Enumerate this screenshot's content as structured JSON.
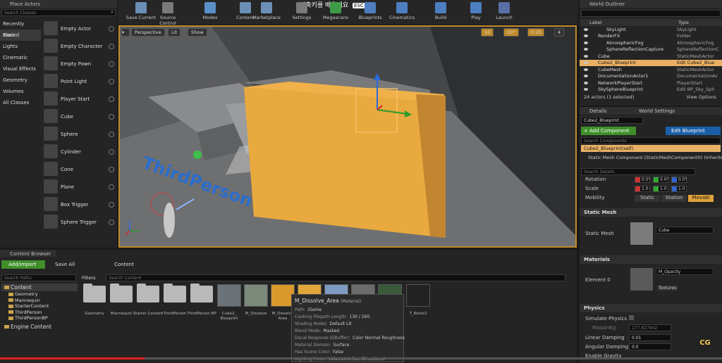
{
  "place_actors": {
    "title": "Place Actors",
    "search_placeholder": "Search Classes",
    "categories": [
      "Recently Placed",
      "Basic",
      "Lights",
      "Cinematic",
      "Visual Effects",
      "Geometry",
      "Volumes",
      "All Classes"
    ],
    "items": [
      "Empty Actor",
      "Empty Character",
      "Empty Pawn",
      "Point Light",
      "Player Start",
      "Cube",
      "Sphere",
      "Cylinder",
      "Cone",
      "Plane",
      "Box Trigger",
      "Sphere Trigger"
    ]
  },
  "toolbar": {
    "overlay_text": "단축키를 배우세요",
    "esc_key": "ESC",
    "buttons": [
      "Save Current",
      "Source Control",
      "Modes",
      "Content",
      "Marketplace",
      "Settings",
      "Megascans",
      "Blueprints",
      "Cinematics",
      "Build",
      "Play",
      "Launch"
    ]
  },
  "viewport": {
    "perspective": "Perspective",
    "lit": "Lit",
    "show": "Show",
    "snap_grid": "10",
    "snap_rot": "10°",
    "snap_scale": "0.25",
    "cam_speed": "4",
    "floor_text": "ThirdPerson"
  },
  "outliner": {
    "title": "World Outliner",
    "col_label": "Label",
    "col_type": "Type",
    "rows": [
      {
        "label": "SkyLight",
        "type": "SkyLight"
      },
      {
        "label": "RenderFX",
        "type": "Folder"
      },
      {
        "label": "AtmosphericFog",
        "type": "AtmosphericFog"
      },
      {
        "label": "SphereReflectionCapture",
        "type": "SphereReflectionC"
      },
      {
        "label": "Cube",
        "type": "StaticMeshActor"
      },
      {
        "label": "Cube2_Blueprint",
        "type": "Edit Cube2_Blue"
      },
      {
        "label": "CubeMesh",
        "type": "StaticMeshActor"
      },
      {
        "label": "DocumentationActor1",
        "type": "DocumentationAc"
      },
      {
        "label": "NetworkPlayerStart",
        "type": "PlayerStart"
      },
      {
        "label": "SkySphereBlueprint",
        "type": "Edit BP_Sky_Sph"
      }
    ],
    "footer_count": "24 actors (1 selected)",
    "view_options": "View Options"
  },
  "details": {
    "tab_details": "Details",
    "tab_world": "World Settings",
    "actor_name": "Cube2_Blueprint",
    "add_component": "+ Add Component",
    "edit_blueprint": "Edit Blueprint",
    "search_components": "Search Components",
    "self_component": "Cube2_Blueprint(self)",
    "mesh_component": "Static Mesh Component (StaticMeshComponent0) (Inherited)",
    "search_details": "Search Details",
    "rotation_label": "Rotation",
    "rotation": [
      "0.0°",
      "0.0°",
      "0.0°"
    ],
    "scale_label": "Scale",
    "scale": [
      "1.0",
      "1.0",
      "1.0"
    ],
    "mobility_label": "Mobility",
    "mobility_options": [
      "Static",
      "Station",
      "Movabl"
    ],
    "static_mesh_section": "Static Mesh",
    "static_mesh_label": "Static Mesh",
    "static_mesh_value": "Cube",
    "materials_section": "Materials",
    "element_label": "Element 0",
    "material_value": "M_Opacity",
    "textures_btn": "Textures",
    "physics_section": "Physics",
    "simulate_physics": "Simulate Physics",
    "mass_label": "MassInKg",
    "mass_value": "177.827942",
    "linear_damping_label": "Linear Damping",
    "linear_damping": "0.01",
    "angular_damping_label": "Angular Damping",
    "angular_damping": "0.0",
    "enable_gravity": "Enable Gravity"
  },
  "content_browser": {
    "title": "Content Browser",
    "add_import": "Add/Import",
    "save_all": "Save All",
    "path": "Content",
    "search_paths": "Search Paths",
    "filters": "Filters",
    "search_content": "Search Content",
    "tree": [
      "Content",
      "Geometry",
      "Mannequin",
      "StarterContent",
      "ThirdPerson",
      "ThirdPersonBP",
      "Engine Content"
    ],
    "folders": [
      "Geometry",
      "Mannequin",
      "Starter Content",
      "ThirdPerson",
      "ThirdPerson BP"
    ],
    "assets": [
      "Cube2_ Blueprint",
      "M_Dissolve",
      "M_Dissolve Area",
      "",
      "",
      "",
      "",
      "T_Noise2"
    ]
  },
  "tooltip": {
    "title": "M_Dissolve_Area",
    "kind": "(Material)",
    "lines": [
      {
        "k": "Path:",
        "v": "/Game"
      },
      {
        "k": "Cooking Filepath Length:",
        "v": "130 / 260"
      },
      {
        "k": "Shading Model:",
        "v": "Default Lit"
      },
      {
        "k": "Blend Mode:",
        "v": "Masked"
      },
      {
        "k": "Decal Response (DBuffer):",
        "v": "Color Normal Roughness"
      },
      {
        "k": "Material Domain:",
        "v": "Surface"
      },
      {
        "k": "Has Scene Color:",
        "v": "False"
      },
      {
        "k": "Lighting Mode:",
        "v": "Volumetric Non Directional"
      }
    ]
  },
  "watermark": "CG",
  "video_progress": 0.2,
  "colors": {
    "accent": "#e0a23a",
    "selection": "#e8b064",
    "add_green": "#3f8f2a",
    "blue_btn": "#1a5fa8"
  }
}
